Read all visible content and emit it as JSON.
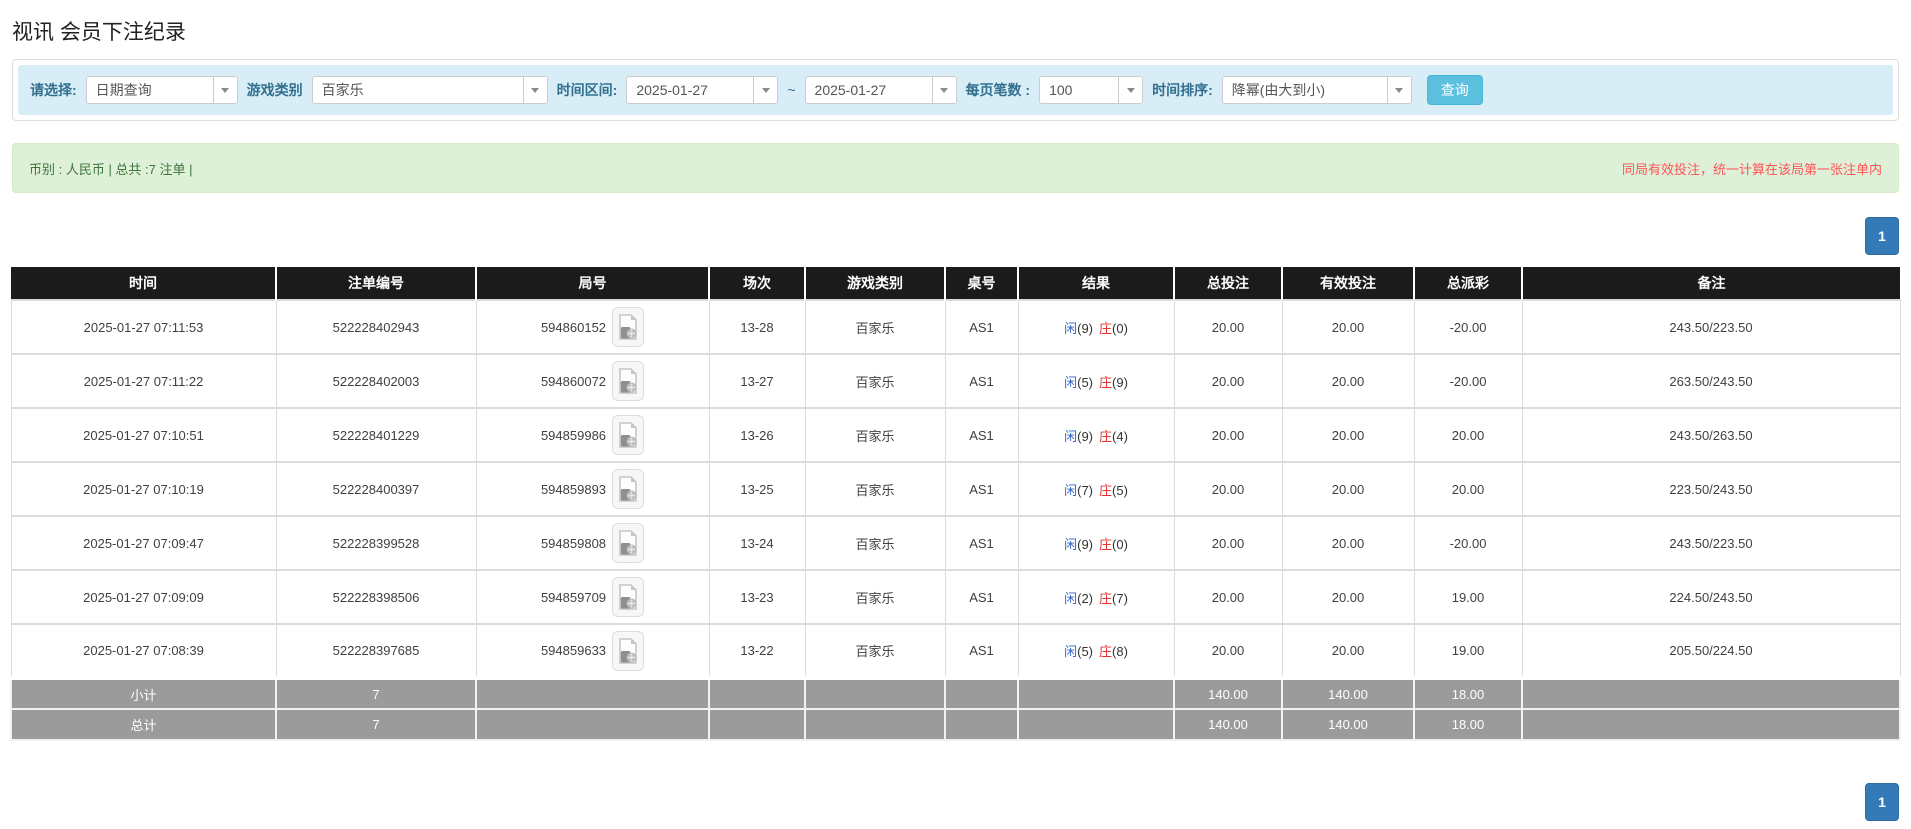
{
  "page": {
    "title": "视讯 会员下注纪录"
  },
  "filters": {
    "query_type": {
      "label": "请选择:",
      "value": "日期查询"
    },
    "game_category": {
      "label": "游戏类别",
      "value": "百家乐"
    },
    "time_range": {
      "label": "时间区间:",
      "from": "2025-01-27",
      "separator": "~",
      "to": "2025-01-27"
    },
    "page_size": {
      "label": "每页笔数 :",
      "value": "100"
    },
    "time_sort": {
      "label": "时间排序:",
      "value": "降幂(由大到小)"
    },
    "search_button_label": "查询"
  },
  "info_bar": {
    "currency_summary": "币别 : 人民币 | 总共 :7 注单 |",
    "notice": "同局有效投注，统一计算在该局第一张注单内"
  },
  "pagination": {
    "current_page": "1"
  },
  "table": {
    "headers": [
      "时间",
      "注单编号",
      "局号",
      "场次",
      "游戏类别",
      "桌号",
      "结果",
      "总投注",
      "有效投注",
      "总派彩",
      "备注"
    ],
    "rows": [
      {
        "time": "2025-01-27 07:11:53",
        "bet_id": "522228402943",
        "round_id": "594860152",
        "session": "13-28",
        "game": "百家乐",
        "table_no": "AS1",
        "player": "闲",
        "player_score": "(9)",
        "banker": "庄",
        "banker_score": "(0)",
        "total_bet": "20.00",
        "valid_bet": "20.00",
        "payout": "-20.00",
        "remark": "243.50/223.50"
      },
      {
        "time": "2025-01-27 07:11:22",
        "bet_id": "522228402003",
        "round_id": "594860072",
        "session": "13-27",
        "game": "百家乐",
        "table_no": "AS1",
        "player": "闲",
        "player_score": "(5)",
        "banker": "庄",
        "banker_score": "(9)",
        "total_bet": "20.00",
        "valid_bet": "20.00",
        "payout": "-20.00",
        "remark": "263.50/243.50"
      },
      {
        "time": "2025-01-27 07:10:51",
        "bet_id": "522228401229",
        "round_id": "594859986",
        "session": "13-26",
        "game": "百家乐",
        "table_no": "AS1",
        "player": "闲",
        "player_score": "(9)",
        "banker": "庄",
        "banker_score": "(4)",
        "total_bet": "20.00",
        "valid_bet": "20.00",
        "payout": "20.00",
        "remark": "243.50/263.50"
      },
      {
        "time": "2025-01-27 07:10:19",
        "bet_id": "522228400397",
        "round_id": "594859893",
        "session": "13-25",
        "game": "百家乐",
        "table_no": "AS1",
        "player": "闲",
        "player_score": "(7)",
        "banker": "庄",
        "banker_score": "(5)",
        "total_bet": "20.00",
        "valid_bet": "20.00",
        "payout": "20.00",
        "remark": "223.50/243.50"
      },
      {
        "time": "2025-01-27 07:09:47",
        "bet_id": "522228399528",
        "round_id": "594859808",
        "session": "13-24",
        "game": "百家乐",
        "table_no": "AS1",
        "player": "闲",
        "player_score": "(9)",
        "banker": "庄",
        "banker_score": "(0)",
        "total_bet": "20.00",
        "valid_bet": "20.00",
        "payout": "-20.00",
        "remark": "243.50/223.50"
      },
      {
        "time": "2025-01-27 07:09:09",
        "bet_id": "522228398506",
        "round_id": "594859709",
        "session": "13-23",
        "game": "百家乐",
        "table_no": "AS1",
        "player": "闲",
        "player_score": "(2)",
        "banker": "庄",
        "banker_score": "(7)",
        "total_bet": "20.00",
        "valid_bet": "20.00",
        "payout": "19.00",
        "remark": "224.50/243.50"
      },
      {
        "time": "2025-01-27 07:08:39",
        "bet_id": "522228397685",
        "round_id": "594859633",
        "session": "13-22",
        "game": "百家乐",
        "table_no": "AS1",
        "player": "闲",
        "player_score": "(5)",
        "banker": "庄",
        "banker_score": "(8)",
        "total_bet": "20.00",
        "valid_bet": "20.00",
        "payout": "19.00",
        "remark": "205.50/224.50"
      }
    ],
    "subtotal": {
      "label": "小计",
      "count": "7",
      "total_bet": "140.00",
      "valid_bet": "140.00",
      "payout": "18.00"
    },
    "total": {
      "label": "总计",
      "count": "7",
      "total_bet": "140.00",
      "valid_bet": "140.00",
      "payout": "18.00"
    }
  },
  "icons": {
    "dropdown": "chevron-down-icon",
    "video": "video-playback-icon"
  },
  "colors": {
    "filter_bar_bg": "#d9edf7",
    "filter_label": "#31708f",
    "search_button": "#5bc0de",
    "info_bar_bg": "#dff0d8",
    "info_text_green": "#3c763d",
    "notice_red": "#ff5555",
    "table_header_bg": "#1b1b1b",
    "summary_row_bg": "#9b9b9b",
    "pager_blue": "#337ab7",
    "bet_amount_blue": "#337ab7",
    "player_blue": "#3366cc",
    "banker_red": "#e53333",
    "negative_red": "#ee2222"
  }
}
